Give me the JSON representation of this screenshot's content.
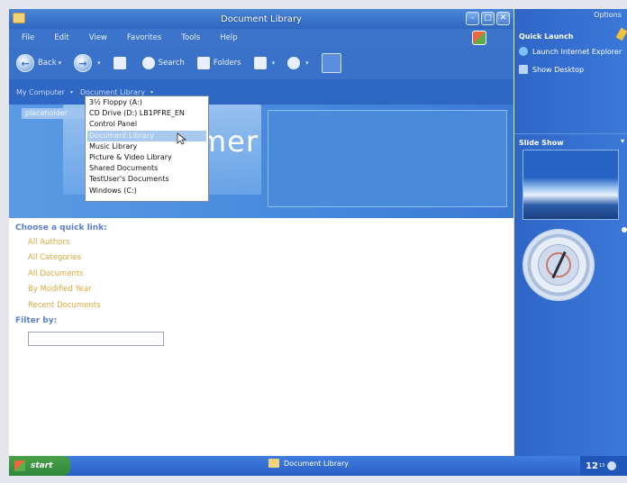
{
  "window": {
    "title": "Document Library",
    "controls": [
      "minimize",
      "maximize",
      "close"
    ]
  },
  "menu": {
    "items": [
      "File",
      "Edit",
      "View",
      "Favorites",
      "Tools",
      "Help"
    ]
  },
  "toolbar": {
    "back_label": "Back",
    "search_label": "Search",
    "folders_label": "Folders"
  },
  "address": {
    "crumbs": [
      "My Computer",
      "Document Library"
    ]
  },
  "banner": {
    "tab_label": "placeholder",
    "text": "mer"
  },
  "dropdown": {
    "items": [
      "3½ Floppy (A:)",
      "CD Drive (D:) LB1PFRE_EN",
      "Control Panel",
      "Document Library",
      "Music Library",
      "Picture & Video Library",
      "Shared Documents",
      "TestUser's Documents",
      "Windows (C:)"
    ],
    "selected_index": 3
  },
  "content": {
    "quick_link_heading": "Choose a quick link:",
    "quick_links": [
      "All Authors",
      "All Categories",
      "All Documents",
      "By Modified Year",
      "Recent Documents"
    ],
    "filter_label": "Filter by:",
    "filter_value": ""
  },
  "sidepane": {
    "options_label": "Options",
    "quick_launch_title": "Quick Launch",
    "quick_launch_items": [
      "Launch Internet Explorer",
      "Show Desktop"
    ],
    "slideshow_title": "Slide Show"
  },
  "taskbar": {
    "start_label": "start",
    "task_label": "Document Library",
    "clock": "12",
    "clock_sup": "13"
  },
  "colors": {
    "accent": "#3a72ca",
    "link": "#d6aa3c",
    "heading": "#5a7fd0"
  }
}
